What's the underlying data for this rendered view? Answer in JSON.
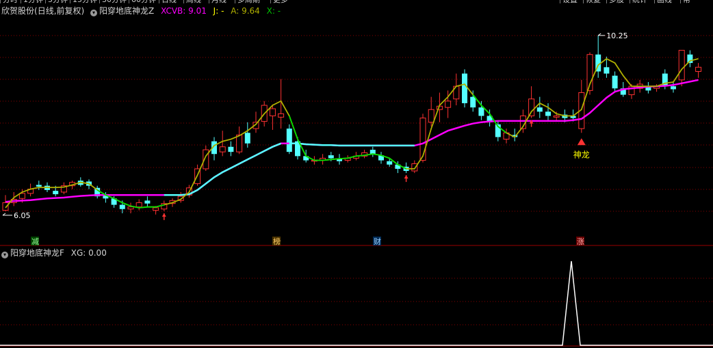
{
  "top_tabs": [
    "分时",
    "1分钟",
    "5分钟",
    "15分钟",
    "30分钟",
    "60分钟",
    "日线",
    "周线",
    "月线",
    "多周期",
    "更多"
  ],
  "top_right_tabs": [
    "设置",
    "恢复",
    "多股",
    "统计",
    "画线",
    "帮"
  ],
  "header": {
    "stock_name": "欣贺股份",
    "period": "(日线,前复权)",
    "indicator_name": "阳穿地底神龙Z",
    "xcvb_label": "XCVB: 9.01",
    "j_label": "J: -",
    "a_label": "A: 9.64",
    "x_label": "X: -"
  },
  "sub_header": {
    "indicator_name": "阳穿地底神龙F",
    "xg_label": "XG: 0.00"
  },
  "colors": {
    "up": "#ff3232",
    "down": "#54ffff",
    "xcvb_line": "#ff00ff",
    "a_line_up": "#b0b000",
    "a_line_down": "#00dd00",
    "trend_line": "#54ffff",
    "grid": "#8b0000",
    "signal": "#ffffff"
  },
  "chart_data": {
    "type": "candlestick",
    "title": "欣贺股份 (日线,前复权)",
    "yrange": [
      5.5,
      10.7
    ],
    "grid": true,
    "price_labels": {
      "high": "10.25",
      "low": "6.05"
    },
    "signal_label": "神龙",
    "event_markers": [
      {
        "label": "减",
        "bg": "#004400",
        "color": "#9aff9a"
      },
      {
        "label": "榜",
        "bg": "#4a3300",
        "color": "#ffcc66"
      },
      {
        "label": "财",
        "bg": "#002a55",
        "color": "#9ad0ff"
      },
      {
        "label": "涨",
        "bg": "#660000",
        "color": "#ffaaaa"
      }
    ],
    "candles": [
      [
        6.12,
        6.48,
        6.3,
        6.1
      ],
      [
        6.3,
        6.55,
        6.38,
        6.22
      ],
      [
        6.4,
        6.62,
        6.52,
        6.3
      ],
      [
        6.52,
        6.75,
        6.62,
        6.45
      ],
      [
        6.72,
        6.82,
        6.68,
        6.6
      ],
      [
        6.7,
        6.78,
        6.6,
        6.55
      ],
      [
        6.58,
        6.7,
        6.5,
        6.45
      ],
      [
        6.55,
        6.78,
        6.7,
        6.5
      ],
      [
        6.7,
        6.82,
        6.78,
        6.62
      ],
      [
        6.82,
        6.9,
        6.72,
        6.68
      ],
      [
        6.8,
        6.85,
        6.7,
        6.62
      ],
      [
        6.65,
        6.7,
        6.45,
        6.4
      ],
      [
        6.48,
        6.55,
        6.4,
        6.3
      ],
      [
        6.4,
        6.45,
        6.25,
        6.18
      ],
      [
        6.25,
        6.35,
        6.15,
        6.05
      ],
      [
        6.15,
        6.3,
        6.2,
        6.05
      ],
      [
        6.2,
        6.38,
        6.3,
        6.12
      ],
      [
        6.35,
        6.45,
        6.28,
        6.2
      ],
      [
        6.12,
        6.22,
        6.18,
        6.02
      ],
      [
        6.15,
        6.35,
        6.28,
        6.1
      ],
      [
        6.28,
        6.4,
        6.35,
        6.2
      ],
      [
        6.35,
        6.55,
        6.45,
        6.3
      ],
      [
        6.48,
        6.72,
        6.65,
        6.42
      ],
      [
        6.75,
        7.2,
        7.1,
        6.7
      ],
      [
        7.1,
        7.65,
        7.55,
        7.05
      ],
      [
        7.75,
        7.85,
        7.45,
        7.3
      ],
      [
        7.5,
        8.0,
        7.62,
        7.4
      ],
      [
        7.62,
        7.75,
        7.5,
        7.4
      ],
      [
        7.5,
        8.1,
        7.9,
        7.45
      ],
      [
        7.95,
        8.2,
        7.7,
        7.6
      ],
      [
        8.05,
        8.45,
        8.2,
        7.95
      ],
      [
        8.22,
        8.7,
        8.6,
        8.1
      ],
      [
        8.35,
        8.62,
        8.52,
        8.02
      ],
      [
        8.32,
        9.22,
        8.4,
        8.05
      ],
      [
        8.05,
        8.15,
        7.5,
        7.45
      ],
      [
        7.75,
        7.85,
        7.4,
        7.32
      ],
      [
        7.4,
        7.55,
        7.3,
        7.25
      ],
      [
        7.28,
        7.4,
        7.3,
        7.2
      ],
      [
        7.3,
        7.45,
        7.35,
        7.2
      ],
      [
        7.42,
        7.5,
        7.35,
        7.28
      ],
      [
        7.35,
        7.45,
        7.28,
        7.2
      ],
      [
        7.3,
        7.42,
        7.35,
        7.25
      ],
      [
        7.35,
        7.5,
        7.4,
        7.3
      ],
      [
        7.4,
        7.55,
        7.48,
        7.35
      ],
      [
        7.55,
        7.62,
        7.45,
        7.38
      ],
      [
        7.42,
        7.5,
        7.3,
        7.22
      ],
      [
        7.28,
        7.35,
        7.2,
        7.15
      ],
      [
        7.2,
        7.28,
        7.1,
        7.0
      ],
      [
        7.15,
        7.25,
        7.05,
        7.0
      ],
      [
        7.05,
        7.3,
        7.22,
        7.0
      ],
      [
        7.3,
        8.4,
        8.3,
        7.25
      ],
      [
        8.2,
        8.8,
        8.5,
        8.1
      ],
      [
        8.5,
        8.9,
        8.58,
        8.2
      ],
      [
        8.55,
        8.95,
        8.7,
        8.3
      ],
      [
        8.75,
        9.35,
        9.05,
        8.6
      ],
      [
        9.35,
        9.45,
        8.65,
        8.55
      ],
      [
        8.8,
        8.95,
        8.55,
        8.45
      ],
      [
        8.55,
        8.7,
        8.35,
        8.25
      ],
      [
        8.35,
        8.5,
        8.2,
        8.1
      ],
      [
        8.15,
        8.22,
        7.85,
        7.75
      ],
      [
        7.8,
        8.05,
        7.95,
        7.7
      ],
      [
        7.9,
        8.05,
        7.85,
        7.75
      ],
      [
        8.05,
        8.5,
        8.35,
        7.95
      ],
      [
        8.35,
        9.05,
        8.75,
        8.3
      ],
      [
        8.55,
        8.8,
        8.45,
        8.3
      ],
      [
        8.45,
        8.65,
        8.35,
        8.25
      ],
      [
        8.32,
        8.45,
        8.35,
        8.25
      ],
      [
        8.38,
        8.5,
        8.3,
        8.2
      ],
      [
        8.35,
        8.5,
        8.3,
        8.22
      ],
      [
        8.05,
        9.2,
        8.9,
        7.95
      ],
      [
        8.95,
        9.85,
        9.8,
        8.85
      ],
      [
        9.8,
        10.25,
        9.4,
        9.25
      ],
      [
        9.5,
        9.75,
        9.35,
        9.25
      ],
      [
        9.3,
        9.4,
        9.0,
        8.9
      ],
      [
        9.0,
        9.15,
        8.85,
        8.8
      ],
      [
        8.85,
        9.1,
        9.05,
        8.75
      ],
      [
        9.0,
        9.2,
        9.1,
        8.9
      ],
      [
        9.05,
        9.15,
        8.95,
        8.88
      ],
      [
        9.0,
        9.1,
        9.05,
        8.92
      ],
      [
        9.35,
        9.45,
        9.05,
        8.98
      ],
      [
        9.05,
        9.15,
        8.98,
        8.9
      ],
      [
        9.2,
        9.85,
        9.9,
        9.05
      ],
      [
        9.8,
        9.9,
        9.6,
        9.5
      ],
      [
        9.4,
        9.6,
        9.5,
        9.25
      ]
    ],
    "xcvb": [
      6.32,
      6.34,
      6.35,
      6.36,
      6.38,
      6.4,
      6.41,
      6.42,
      6.44,
      6.46,
      6.47,
      6.48,
      6.48,
      6.48,
      6.48,
      6.48,
      6.48,
      6.48,
      6.48,
      6.48,
      6.48,
      6.48,
      6.5,
      6.6,
      6.75,
      6.9,
      7.02,
      7.12,
      7.22,
      7.32,
      7.42,
      7.52,
      7.62,
      7.7,
      7.7,
      7.7,
      7.68,
      7.67,
      7.66,
      7.66,
      7.65,
      7.65,
      7.65,
      7.65,
      7.65,
      7.65,
      7.65,
      7.65,
      7.65,
      7.65,
      7.7,
      7.8,
      7.9,
      8.0,
      8.06,
      8.12,
      8.17,
      8.2,
      8.22,
      8.23,
      8.23,
      8.23,
      8.23,
      8.23,
      8.23,
      8.23,
      8.23,
      8.23,
      8.25,
      8.28,
      8.42,
      8.6,
      8.78,
      8.92,
      8.98,
      9.0,
      9.02,
      9.04,
      9.05,
      9.06,
      9.08,
      9.12,
      9.16,
      9.2
    ],
    "a": [
      6.18,
      6.42,
      6.55,
      6.62,
      6.66,
      6.66,
      6.66,
      6.67,
      6.72,
      6.78,
      6.75,
      6.6,
      6.48,
      6.4,
      6.3,
      6.22,
      6.18,
      6.2,
      6.2,
      6.25,
      6.3,
      6.38,
      6.55,
      6.95,
      7.4,
      7.65,
      7.75,
      7.8,
      7.88,
      8.0,
      8.15,
      8.4,
      8.6,
      8.7,
      8.35,
      7.8,
      7.4,
      7.3,
      7.3,
      7.32,
      7.34,
      7.35,
      7.4,
      7.42,
      7.45,
      7.42,
      7.35,
      7.2,
      7.1,
      7.1,
      7.4,
      8.05,
      8.6,
      8.8,
      9.05,
      9.1,
      8.85,
      8.6,
      8.4,
      8.1,
      7.95,
      7.85,
      8.1,
      8.45,
      8.65,
      8.55,
      8.4,
      8.35,
      8.35,
      8.5,
      9.1,
      9.55,
      9.7,
      9.6,
      9.3,
      9.05,
      9.05,
      9.05,
      9.05,
      9.12,
      9.15,
      9.45,
      9.65,
      9.7
    ],
    "a_down_segments": [
      [
        11,
        19
      ],
      [
        34,
        48
      ],
      [
        56,
        60
      ]
    ],
    "trend_segment": {
      "start": 19,
      "end": 33
    },
    "trend_segment_2": {
      "start": 34,
      "end": 49
    },
    "red_arrows": [
      19,
      48,
      63
    ],
    "high_label_index": 71,
    "low_label_index": 0,
    "signal_index": 69,
    "event_marker_indices": [
      5,
      33,
      45,
      69
    ],
    "xg": {
      "spike_index": 69,
      "spike_value": 1,
      "baseline": 0
    }
  }
}
